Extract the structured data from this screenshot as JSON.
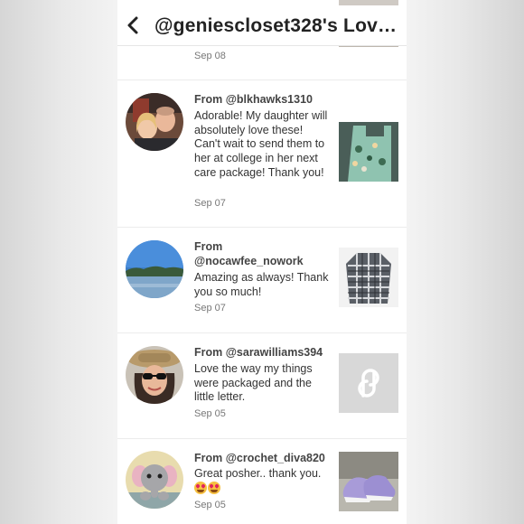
{
  "header": {
    "title": "@geniescloset328's Love...",
    "back_icon": "chevron-left-icon"
  },
  "reviews": [
    {
      "from": "",
      "message": "",
      "date": "Sep 08",
      "avatar_icon": "avatar",
      "thumbnail_icon": "listing-thumbnail"
    },
    {
      "from": "From @blkhawks1310",
      "message": "Adorable! My daughter will absolutely love these! Can't wait to send them to her at college in her next care package! Thank you!",
      "date": "Sep 07",
      "avatar_icon": "couple-photo-avatar",
      "thumbnail_icon": "green-print-dress-thumbnail"
    },
    {
      "from": "From @nocawfee_nowork",
      "message": "Amazing as always! Thank you so much!",
      "date": "Sep 07",
      "avatar_icon": "lake-landscape-avatar",
      "thumbnail_icon": "plaid-shirt-thumbnail"
    },
    {
      "from": "From @sarawilliams394",
      "message": "Love the way my things were packaged and the little letter.",
      "date": "Sep 05",
      "avatar_icon": "woman-sunglasses-avatar",
      "thumbnail_icon": "poshmark-placeholder-thumbnail"
    },
    {
      "from": "From @crochet_diva820",
      "message": "Great posher.. thank you.",
      "date": "Sep 05",
      "avatar_icon": "crochet-elephant-avatar",
      "thumbnail_icon": "purple-sneakers-thumbnail"
    }
  ],
  "colors": {
    "text_primary": "#333333",
    "text_secondary": "#777777",
    "divider": "#ececec",
    "placeholder_bg": "#d8d8d8"
  }
}
